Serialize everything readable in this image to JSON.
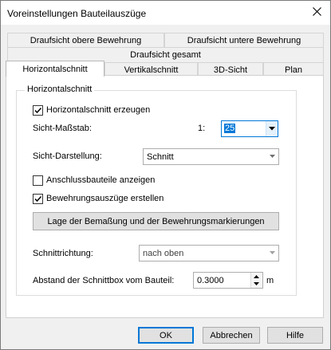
{
  "window": {
    "title": "Voreinstellungen Bauteilauszüge",
    "close_glyph": "✕"
  },
  "tabs": {
    "row1": [
      {
        "label": "Draufsicht obere Bewehrung"
      },
      {
        "label": "Draufsicht untere Bewehrung"
      }
    ],
    "row2": [
      {
        "label": "Draufsicht gesamt"
      }
    ],
    "row3": [
      {
        "label": "Horizontalschnitt",
        "active": true
      },
      {
        "label": "Vertikalschnitt"
      },
      {
        "label": "3D-Sicht"
      },
      {
        "label": "Plan"
      }
    ]
  },
  "group": {
    "title": "Horizontalschnitt",
    "create_section": {
      "label": "Horizontalschnitt erzeugen",
      "checked": true
    },
    "view_scale": {
      "label": "Sicht-Maßstab:",
      "prefix": "1:",
      "value": "25"
    },
    "view_display": {
      "label": "Sicht-Darstellung:",
      "value": "Schnitt"
    },
    "connect_parts": {
      "label": "Anschlussbauteile anzeigen",
      "checked": false
    },
    "create_rebar": {
      "label": "Bewehrungsauszüge erstellen",
      "checked": true
    },
    "position_button": {
      "label": "Lage der Bemaßung und der Bewehrungsmarkierungen"
    },
    "cut_direction": {
      "label": "Schnittrichtung:",
      "value": "nach oben"
    },
    "distance": {
      "label": "Abstand der Schnittbox vom Bauteil:",
      "value": "0.3000",
      "unit": "m"
    }
  },
  "footer": {
    "ok": "OK",
    "cancel": "Abbrechen",
    "help": "Hilfe"
  },
  "colors": {
    "accent": "#0078d7",
    "panel_bg": "#ffffff",
    "dialog_bg": "#f0f0f0"
  }
}
